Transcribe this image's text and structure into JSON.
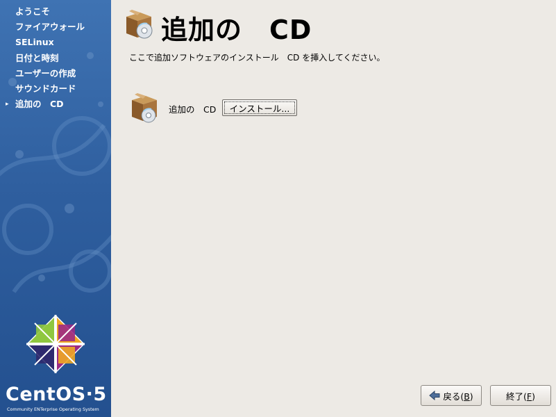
{
  "sidebar": {
    "steps": [
      {
        "label": "ようこそ"
      },
      {
        "label": "ファイアウォール"
      },
      {
        "label": "SELinux"
      },
      {
        "label": "日付と時刻"
      },
      {
        "label": "ユーザーの作成"
      },
      {
        "label": "サウンドカード"
      },
      {
        "label": "追加の　CD",
        "current": true
      }
    ],
    "brand": "CentOS",
    "version": "5",
    "tagline": "Community ENTerprise Operating System"
  },
  "page": {
    "title": "追加の　CD",
    "description": "ここで追加ソフトウェアのインストール　CD を挿入してください。",
    "cd_item_label": "追加の　CD",
    "install_button": "インストール..."
  },
  "buttons": {
    "back_label": "戻る(",
    "back_mnemonic": "B",
    "finish_label": "終了(",
    "finish_mnemonic": "F",
    "close_paren": ")"
  },
  "colors": {
    "sidebar_top": "#3f73b3",
    "sidebar_bottom": "#23508f",
    "background": "#edeae5"
  },
  "icons": {
    "title": "software-box-cd-icon",
    "item": "software-box-cd-icon",
    "back": "arrow-left-icon",
    "current_step": "triangle-right-icon"
  }
}
